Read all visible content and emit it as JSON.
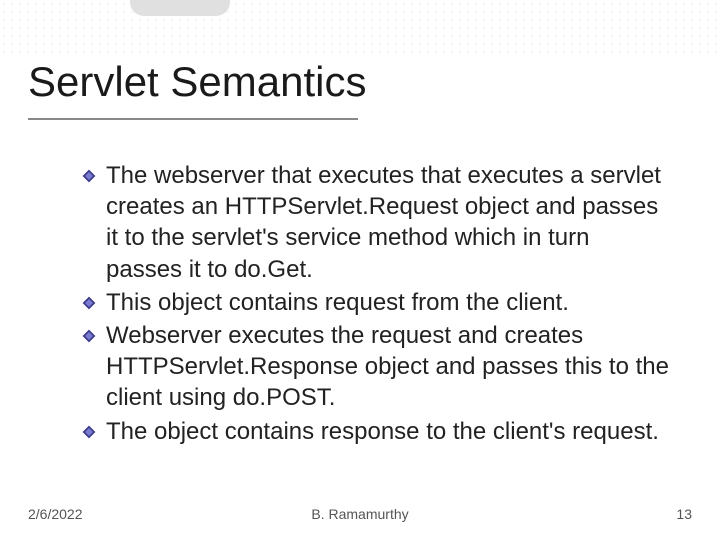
{
  "title": "Servlet Semantics",
  "bullets": [
    "The webserver that executes that executes a servlet creates an HTTPServlet.Request object and passes it to the servlet's service method which in turn passes it to do.Get.",
    "This object contains request from the client.",
    "Webserver executes the request and creates HTTPServlet.Response object and passes this to the client using do.POST.",
    "The object contains response to the client's request."
  ],
  "footer": {
    "date": "2/6/2022",
    "author": "B. Ramamurthy",
    "page": "13"
  }
}
